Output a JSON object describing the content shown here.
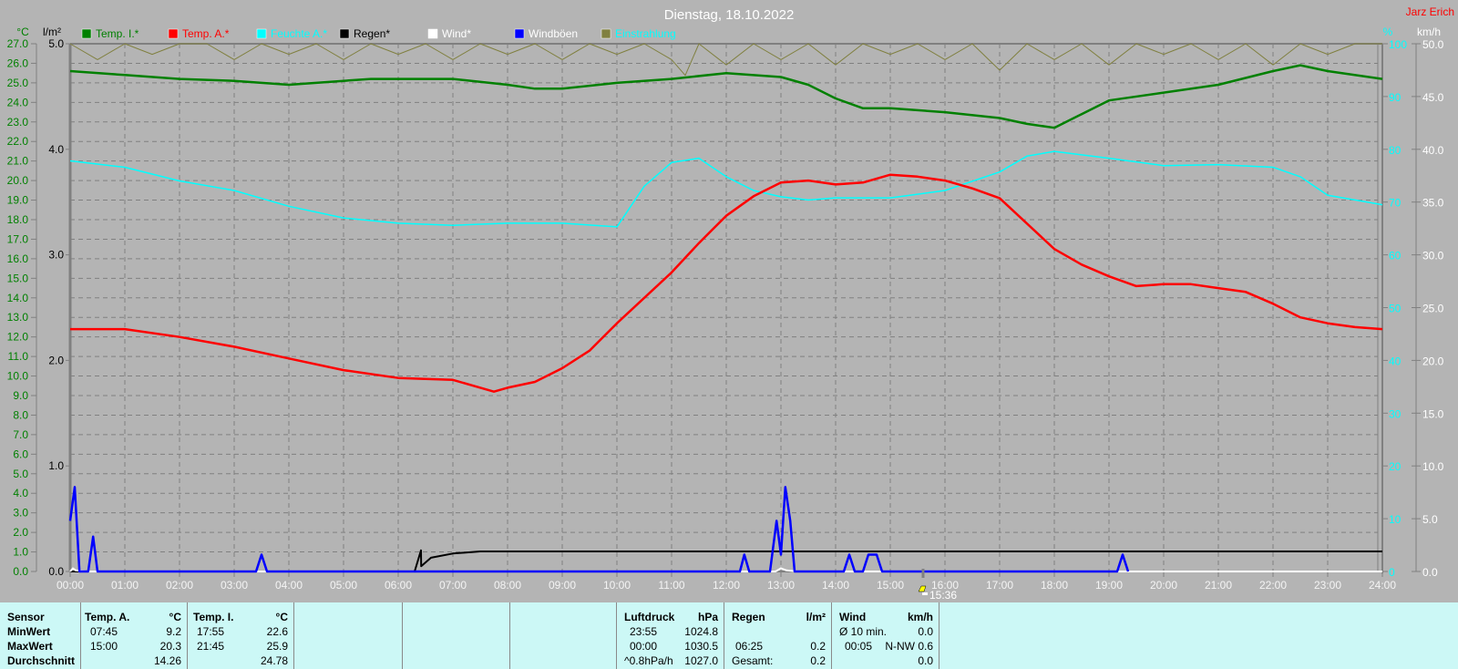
{
  "title": "Dienstag, 18.10.2022",
  "author": "Jarz Erich",
  "colors": {
    "temp_i": "#008000",
    "temp_a": "#ff0000",
    "humidity": "#00ffff",
    "rain": "#000000",
    "wind": "#ffffff",
    "gusts": "#0000ff",
    "radiation": "#808040",
    "background": "#b4b4b4",
    "table": "#ccf8f6"
  },
  "axis_units": {
    "left_temp": "°C",
    "left_rain": "l/m²",
    "right_hum": "%",
    "right_wind": "km/h"
  },
  "current_time": "15:36",
  "chart_data": {
    "type": "line",
    "title": "Dienstag, 18.10.2022",
    "xlabel": "",
    "xlim": [
      0,
      24
    ],
    "x_ticks": [
      "00:00",
      "01:00",
      "02:00",
      "03:00",
      "04:00",
      "05:00",
      "06:00",
      "07:00",
      "08:00",
      "09:00",
      "10:00",
      "11:00",
      "12:00",
      "13:00",
      "14:00",
      "15:00",
      "16:00",
      "17:00",
      "18:00",
      "19:00",
      "20:00",
      "21:00",
      "22:00",
      "23:00",
      "24:00"
    ],
    "axes": {
      "temp": {
        "label": "°C",
        "range": [
          0,
          27
        ],
        "step": 1
      },
      "rain": {
        "label": "l/m²",
        "range": [
          0,
          5
        ],
        "step": 1
      },
      "humidity": {
        "label": "%",
        "range": [
          0,
          100
        ],
        "step": 10
      },
      "wind": {
        "label": "km/h",
        "range": [
          0,
          50
        ],
        "step": 5
      }
    },
    "grid": true,
    "legend": [
      {
        "name": "Temp. I.*",
        "color": "#008000"
      },
      {
        "name": "Temp. A.*",
        "color": "#ff0000"
      },
      {
        "name": "Feuchte A.*",
        "color": "#00ffff"
      },
      {
        "name": "Regen*",
        "color": "#000000"
      },
      {
        "name": "Wind*",
        "color": "#ffffff"
      },
      {
        "name": "Windböen",
        "color": "#0000ff"
      },
      {
        "name": "Einstrahlung",
        "color": "#808040"
      }
    ],
    "legend_placement": "top",
    "series": [
      {
        "name": "Temp. I.*",
        "axis": "temp",
        "color": "#008000",
        "width": 2.5,
        "x": [
          0,
          1,
          2,
          3,
          4,
          5,
          5.5,
          7,
          8,
          8.5,
          9,
          10,
          11,
          12,
          13,
          13.5,
          14,
          14.5,
          15,
          16,
          17,
          17.5,
          18,
          18.5,
          19,
          20,
          21,
          22,
          22.5,
          23,
          24
        ],
        "y": [
          25.6,
          25.4,
          25.2,
          25.1,
          24.9,
          25.1,
          25.2,
          25.2,
          24.9,
          24.7,
          24.7,
          25.0,
          25.2,
          25.5,
          25.3,
          24.9,
          24.2,
          23.7,
          23.7,
          23.5,
          23.2,
          22.9,
          22.7,
          23.4,
          24.1,
          24.5,
          24.9,
          25.6,
          25.9,
          25.6,
          25.2
        ]
      },
      {
        "name": "Temp. A.*",
        "axis": "temp",
        "color": "#ff0000",
        "width": 2.5,
        "x": [
          0,
          1,
          2,
          3,
          4,
          5,
          6,
          7,
          7.75,
          8,
          8.5,
          9,
          9.5,
          10,
          10.5,
          11,
          11.5,
          12,
          12.5,
          13,
          13.5,
          14,
          14.5,
          15,
          15.5,
          16,
          16.5,
          17,
          17.5,
          18,
          18.5,
          19,
          19.5,
          20,
          20.5,
          21,
          21.5,
          22,
          22.5,
          23,
          23.5,
          24
        ],
        "y": [
          12.4,
          12.4,
          12.0,
          11.5,
          10.9,
          10.3,
          9.9,
          9.8,
          9.2,
          9.4,
          9.7,
          10.4,
          11.3,
          12.7,
          14.0,
          15.3,
          16.8,
          18.2,
          19.2,
          19.9,
          20.0,
          19.8,
          19.9,
          20.3,
          20.2,
          20.0,
          19.6,
          19.1,
          17.8,
          16.5,
          15.7,
          15.1,
          14.6,
          14.7,
          14.7,
          14.5,
          14.3,
          13.7,
          13.0,
          12.7,
          12.5,
          12.4
        ]
      },
      {
        "name": "Feuchte A.*",
        "axis": "humidity",
        "color": "#00ffff",
        "width": 1.5,
        "x": [
          0,
          1,
          2,
          3,
          4,
          5,
          6,
          7,
          8,
          9,
          10,
          10.5,
          11,
          11.5,
          12,
          12.5,
          13,
          13.5,
          14,
          15,
          16,
          17,
          17.5,
          18,
          19,
          20,
          21,
          22,
          22.5,
          23,
          23.5,
          24
        ],
        "y": [
          77.8,
          76.6,
          74.0,
          72.2,
          69.2,
          67.0,
          66.0,
          65.6,
          66.0,
          66.0,
          65.3,
          73.0,
          77.5,
          78.3,
          74.8,
          72.2,
          71.0,
          70.4,
          70.8,
          70.8,
          72.2,
          75.7,
          78.7,
          79.6,
          78.3,
          76.9,
          77.1,
          76.6,
          74.8,
          71.3,
          70.4,
          69.5
        ]
      },
      {
        "name": "Regen*",
        "axis": "rain",
        "color": "#000000",
        "width": 2,
        "x": [
          0,
          6.3,
          6.4167,
          6.42,
          6.6,
          7,
          7.5,
          24
        ],
        "y": [
          0,
          0,
          0.2,
          0.05,
          0.13,
          0.17,
          0.19,
          0.19
        ]
      },
      {
        "name": "Wind*",
        "axis": "wind",
        "color": "#ffffff",
        "width": 2,
        "x": [
          0,
          0.05,
          0.1,
          0.3,
          0.5,
          12.9,
          13.0,
          13.1,
          13.3,
          24
        ],
        "y": [
          0,
          0.3,
          0.1,
          0,
          0,
          0,
          0.3,
          0.1,
          0,
          0
        ]
      },
      {
        "name": "Windböen",
        "axis": "wind",
        "color": "#0000ff",
        "width": 2.5,
        "x": [
          0,
          0.083,
          0.17,
          0.33,
          0.42,
          0.5,
          3.4,
          3.5,
          3.6,
          12.25,
          12.33,
          12.42,
          12.8,
          12.92,
          13.0,
          13.08,
          13.17,
          13.25,
          14.15,
          14.25,
          14.35,
          14.5,
          14.6,
          14.75,
          14.85,
          19.15,
          19.25,
          19.35
        ],
        "y": [
          4.8,
          8.0,
          0,
          0,
          3.3,
          0,
          0,
          1.6,
          0,
          0,
          1.6,
          0,
          0,
          4.8,
          1.6,
          8.0,
          4.8,
          0,
          0,
          1.6,
          0,
          0,
          1.6,
          1.6,
          0,
          0,
          1.6,
          0
        ]
      },
      {
        "name": "Einstrahlung",
        "axis": "humidity",
        "color": "#808040",
        "width": 1,
        "x": [
          0,
          0.5,
          1,
          1.5,
          2,
          2.5,
          3,
          3.5,
          4,
          4.5,
          5,
          5.5,
          6,
          6.5,
          7,
          7.5,
          8,
          8.5,
          9,
          9.5,
          10,
          10.5,
          11,
          11.25,
          11.5,
          12,
          12.5,
          13,
          13.5,
          14,
          14.5,
          15,
          15.5,
          16,
          16.5,
          17,
          17.5,
          18,
          18.5,
          19,
          19.5,
          20,
          20.5,
          21,
          21.5,
          22,
          22.5,
          23,
          23.5,
          24
        ],
        "y": [
          100,
          97,
          100,
          98,
          100,
          100,
          97,
          100,
          98,
          100,
          97,
          100,
          98,
          100,
          97,
          100,
          98,
          100,
          97,
          100,
          98,
          100,
          97,
          94,
          100,
          96,
          100,
          97,
          100,
          96,
          100,
          98,
          100,
          97,
          100,
          95,
          100,
          97,
          100,
          96,
          100,
          98,
          100,
          97,
          100,
          96,
          100,
          98,
          100,
          100
        ]
      }
    ]
  },
  "table": {
    "sensor": {
      "header": "Sensor",
      "rows": [
        "MinWert",
        "MaxWert",
        "Durchschnitt"
      ]
    },
    "temp_a": {
      "header": "Temp. A.",
      "unit": "°C",
      "rows": [
        {
          "time": "07:45",
          "value": "9.2"
        },
        {
          "time": "15:00",
          "value": "20.3"
        },
        {
          "time": "",
          "value": "14.26"
        }
      ]
    },
    "temp_i": {
      "header": "Temp. I.",
      "unit": "°C",
      "rows": [
        {
          "time": "17:55",
          "value": "22.6"
        },
        {
          "time": "21:45",
          "value": "25.9"
        },
        {
          "time": "",
          "value": "24.78"
        }
      ]
    },
    "pressure": {
      "header": "Luftdruck",
      "unit": "hPa",
      "rows": [
        {
          "time": "23:55",
          "value": "1024.8"
        },
        {
          "time": "00:00",
          "value": "1030.5"
        },
        {
          "time": "^0.8hPa/h",
          "value": "1027.0"
        }
      ]
    },
    "rain": {
      "header": "Regen",
      "unit": "l/m²",
      "rows": [
        {
          "time": "",
          "value": ""
        },
        {
          "time": "06:25",
          "value": "0.2"
        },
        {
          "time": "Gesamt:",
          "value": "0.2"
        }
      ]
    },
    "wind": {
      "header": "Wind",
      "unit": "km/h",
      "rows": [
        {
          "time": "Ø 10 min.",
          "value": "0.0"
        },
        {
          "time": "00:05",
          "value": "N-NW 0.6"
        },
        {
          "time": "",
          "value": "0.0"
        }
      ]
    }
  }
}
